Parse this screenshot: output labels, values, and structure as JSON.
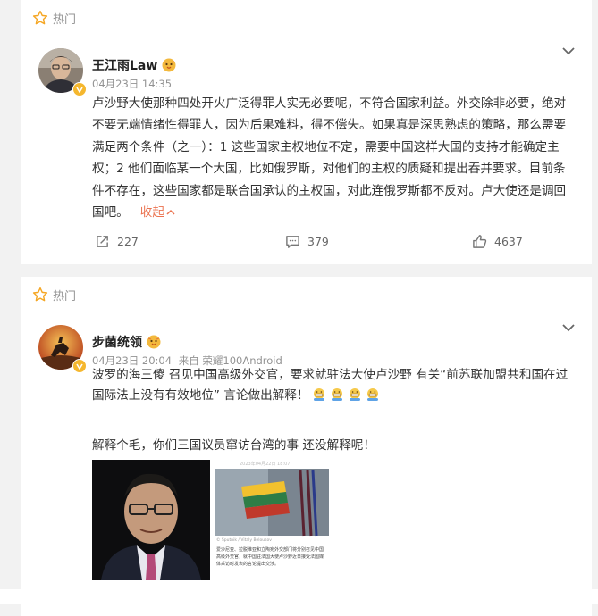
{
  "feed": {
    "posts": [
      {
        "hot_label": "热门",
        "author": "王江雨Law",
        "date": "04月23日 14:35",
        "text": "卢沙野大使那种四处开火广泛得罪人实无必要呢，不符合国家利益。外交除非必要，绝对不要无端情绪性得罪人，因为后果难料，得不偿失。如果真是深思熟虑的策略，那么需要满足两个条件（之一）：1 这些国家主权地位不定，需要中国这样大国的支持才能确定主权；2 他们面临某一个大国，比如俄罗斯，对他们的主权的质疑和提出吞并要求。目前条件不存在，这些国家都是联合国承认的主权国，对此连俄罗斯都不反对。卢大使还是调回国吧。",
        "collapse_label": "收起",
        "share_count": "227",
        "comment_count": "379",
        "like_count": "4637"
      },
      {
        "hot_label": "热门",
        "author": "步菌统领",
        "date": "04月23日 20:04",
        "source": "来自 荣耀100Android",
        "text": "波罗的海三傻 召见中国高级外交官，要求就驻法大使卢沙野 有关“前苏联加盟共和国在过国际法上没有有效地位” 言论做出解释！",
        "text2": "解释个毛，你们三国议员窜访台湾的事 还没解释呢！",
        "photo2_top": "2023年04月22日 18:07",
        "photo2_credit": "© Sputnik / Vitaly Belousov",
        "photo2_caption": "爱沙尼亚、拉脱维亚和立陶宛外交部门将分别召见中国高级外交官，就中国驻法国大使卢沙野近日接受法国媒体采访时发表的言论提出交涉。"
      }
    ]
  },
  "colors": {
    "accent_orange": "#eb7350",
    "meta_gray": "#939393",
    "verified_gold": "#f5b72e"
  },
  "icons": [
    "hot-star-icon",
    "chevron-down-icon",
    "verified-icon",
    "hatching-chick-icon",
    "share-icon",
    "comment-icon",
    "like-icon",
    "grin-emoji-icon"
  ]
}
